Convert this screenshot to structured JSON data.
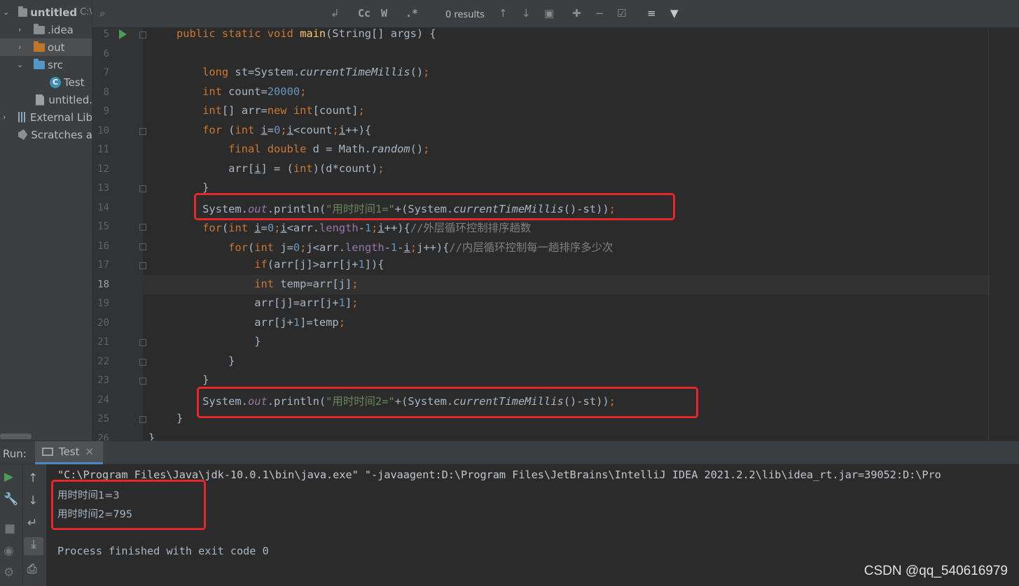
{
  "project_tree": {
    "items": [
      {
        "label": "untitled",
        "suffix": "C:\\",
        "expanded": true,
        "icon": "folder-icon"
      },
      {
        "label": ".idea",
        "expanded": false,
        "icon": "folder-icon"
      },
      {
        "label": "out",
        "expanded": false,
        "icon": "folder-orange-icon",
        "selected": true
      },
      {
        "label": "src",
        "expanded": true,
        "icon": "source-folder-icon"
      },
      {
        "label": "Test",
        "icon": "java-class-icon"
      },
      {
        "label": "untitled.",
        "icon": "module-file-icon"
      },
      {
        "label": "External Lib",
        "expanded": false,
        "icon": "library-icon"
      },
      {
        "label": "Scratches a",
        "icon": "scratches-icon"
      }
    ]
  },
  "find_bar": {
    "search_icon": "search-icon",
    "case_label": "Cc",
    "word_label": "W",
    "regex_label": ".*",
    "results_text": "0 results"
  },
  "editor": {
    "current_line": 18,
    "lines": [
      {
        "no": "5",
        "html": "<span class=\"kw\">public static void </span><span class=\"fn\">main</span>(String[] args) {"
      },
      {
        "no": "6",
        "html": ""
      },
      {
        "no": "7",
        "html": "    <span class=\"kw\">long </span>st=System.<span class=\"it\">currentTimeMillis</span>()<span class=\"kw\">;</span>"
      },
      {
        "no": "8",
        "html": "    <span class=\"kw\">int </span>count=<span class=\"num\">20000</span><span class=\"kw\">;</span>"
      },
      {
        "no": "9",
        "html": "    <span class=\"kw\">int</span>[] arr=<span class=\"kw\">new int</span>[count]<span class=\"kw\">;</span>"
      },
      {
        "no": "10",
        "html": "    <span class=\"kw\">for </span>(<span class=\"kw\">int </span><span class=\"ul\">i</span>=<span class=\"num\">0</span><span class=\"kw\">;</span><span class=\"ul\">i</span>&lt;count<span class=\"kw\">;</span><span class=\"ul\">i</span>++){"
      },
      {
        "no": "11",
        "html": "        <span class=\"kw\">final double </span>d = Math.<span class=\"it\">random</span>()<span class=\"kw\">;</span>"
      },
      {
        "no": "12",
        "html": "        arr[<span class=\"ul\">i</span>] = (<span class=\"kw\">int</span>)(d*count)<span class=\"kw\">;</span>"
      },
      {
        "no": "13",
        "html": "    }"
      },
      {
        "no": "14",
        "html": "    System.<span class=\"sfld\">out</span>.println(<span class=\"str\">\"用时时间1=\"</span>+(System.<span class=\"it\">currentTimeMillis</span>()-st))<span class=\"kw\">;</span>"
      },
      {
        "no": "15",
        "html": "    <span class=\"kw\">for</span>(<span class=\"kw\">int </span><span class=\"ul\">i</span>=<span class=\"num\">0</span><span class=\"kw\">;</span><span class=\"ul\">i</span>&lt;arr.<span class=\"fld\">length</span>-<span class=\"num\">1</span><span class=\"kw\">;</span><span class=\"ul\">i</span>++){<span class=\"cmt\">//外层循环控制排序趟数</span>"
      },
      {
        "no": "16",
        "html": "        <span class=\"kw\">for</span>(<span class=\"kw\">int </span>j=<span class=\"num\">0</span><span class=\"kw\">;</span>j&lt;arr.<span class=\"fld\">length</span>-<span class=\"num\">1</span>-<span class=\"ul\">i</span><span class=\"kw\">;</span>j++){<span class=\"cmt\">//内层循环控制每一趟排序多少次</span>"
      },
      {
        "no": "17",
        "html": "            <span class=\"kw\">if</span>(arr[j]&gt;arr[j+<span class=\"num\">1</span>]){"
      },
      {
        "no": "18",
        "html": "            <span class=\"kw\">int </span>temp=arr[j]<span class=\"kw\">;</span>"
      },
      {
        "no": "19",
        "html": "            arr[j]=arr[j+<span class=\"num\">1</span>]<span class=\"kw\">;</span>"
      },
      {
        "no": "20",
        "html": "            arr[j+<span class=\"num\">1</span>]=temp<span class=\"kw\">;</span>"
      },
      {
        "no": "21",
        "html": "            }"
      },
      {
        "no": "22",
        "html": "        }"
      },
      {
        "no": "23",
        "html": "    }"
      },
      {
        "no": "24",
        "html": "    System.<span class=\"sfld\">out</span>.println(<span class=\"str\">\"用时时间2=\"</span>+(System.<span class=\"it\">currentTimeMillis</span>()-st))<span class=\"kw\">;</span>"
      },
      {
        "no": "25",
        "html": "}"
      },
      {
        "no": "26",
        "html": "}"
      }
    ]
  },
  "run_panel": {
    "label": "Run:",
    "tab_label": "Test",
    "close_icon": "close-icon",
    "console_lines": [
      "\"C:\\Program Files\\Java\\jdk-10.0.1\\bin\\java.exe\" \"-javaagent:D:\\Program Files\\JetBrains\\IntelliJ IDEA 2021.2.2\\lib\\idea_rt.jar=39052:D:\\Pro",
      "用时时间1=3",
      "用时时间2=795",
      "",
      "Process finished with exit code 0"
    ]
  },
  "watermark": "CSDN @qq_540616979",
  "colors": {
    "background": "#2b2b2b",
    "keyword": "#cc7832",
    "number": "#6897bb",
    "string": "#6a8759",
    "highlight_box": "#e8272b"
  }
}
